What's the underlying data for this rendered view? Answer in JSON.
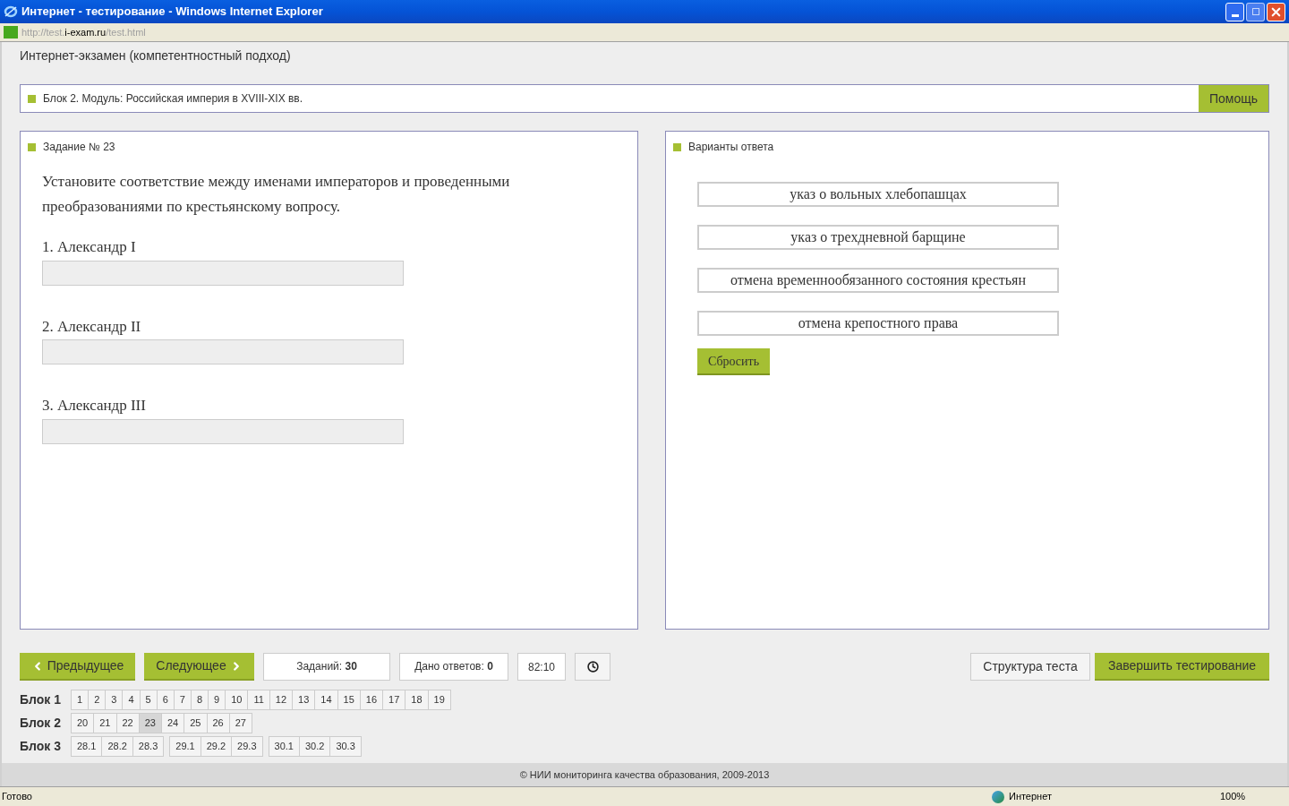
{
  "window": {
    "title": "Интернет - тестирование - Windows Internet Explorer"
  },
  "address": {
    "parts": [
      {
        "text": "http://test.",
        "highlighted": false
      },
      {
        "text": "i-exam.ru",
        "highlighted": true
      },
      {
        "text": "/test.html",
        "highlighted": false
      }
    ]
  },
  "page": {
    "title": "Интернет-экзамен (компетентностный подход)"
  },
  "module": {
    "label": "Блок 2. Модуль: Российская империя в XVIII-XIX вв.",
    "help_button": "Помощь"
  },
  "task": {
    "label": "Задание № 23",
    "question": "Установите соответствие между именами императоров и проведенными преобразованиями по крестьянскому вопросу.",
    "items": [
      {
        "label": "1. Александр I"
      },
      {
        "label": "2. Александр II"
      },
      {
        "label": "3. Александр III"
      }
    ]
  },
  "options": {
    "label": "Варианты ответа",
    "items": [
      "указ о вольных хлебопашцах",
      "указ о трехдневной барщине",
      "отмена временнообязанного состояния крестьян",
      "отмена крепостного права"
    ],
    "reset_button": "Сбросить"
  },
  "nav": {
    "previous": "Предыдущее",
    "next": "Следующее",
    "tasks_count": "Заданий: **30**",
    "answered": "Дано ответов: **0**",
    "timer": "82:10",
    "structure": "Структура теста",
    "finish": "Завершить тестирование"
  },
  "blocks": [
    {
      "label": "Блок 1",
      "groups": [
        [
          {
            "label": "1",
            "selected": false
          },
          {
            "label": "2",
            "selected": false
          },
          {
            "label": "3",
            "selected": false
          },
          {
            "label": "4",
            "selected": false
          },
          {
            "label": "5",
            "selected": false
          },
          {
            "label": "6",
            "selected": false
          },
          {
            "label": "7",
            "selected": false
          },
          {
            "label": "8",
            "selected": false
          },
          {
            "label": "9",
            "selected": false
          },
          {
            "label": "10",
            "selected": false
          },
          {
            "label": "11",
            "selected": false
          },
          {
            "label": "12",
            "selected": false
          },
          {
            "label": "13",
            "selected": false
          },
          {
            "label": "14",
            "selected": false
          },
          {
            "label": "15",
            "selected": false
          },
          {
            "label": "16",
            "selected": false
          },
          {
            "label": "17",
            "selected": false
          },
          {
            "label": "18",
            "selected": false
          },
          {
            "label": "19",
            "selected": false
          }
        ]
      ]
    },
    {
      "label": "Блок 2",
      "groups": [
        [
          {
            "label": "20",
            "selected": false
          },
          {
            "label": "21",
            "selected": false
          },
          {
            "label": "22",
            "selected": false
          },
          {
            "label": "23",
            "selected": true
          },
          {
            "label": "24",
            "selected": false
          },
          {
            "label": "25",
            "selected": false
          },
          {
            "label": "26",
            "selected": false
          },
          {
            "label": "27",
            "selected": false
          }
        ]
      ]
    },
    {
      "label": "Блок 3",
      "groups": [
        [
          {
            "label": "28.1",
            "selected": false
          },
          {
            "label": "28.2",
            "selected": false
          },
          {
            "label": "28.3",
            "selected": false
          }
        ],
        [
          {
            "label": "29.1",
            "selected": false
          },
          {
            "label": "29.2",
            "selected": false
          },
          {
            "label": "29.3",
            "selected": false
          }
        ],
        [
          {
            "label": "30.1",
            "selected": false
          },
          {
            "label": "30.2",
            "selected": false
          },
          {
            "label": "30.3",
            "selected": false
          }
        ]
      ]
    }
  ],
  "footer": {
    "text": "© НИИ мониторинга качества образования, 2009-2013"
  },
  "status_bar": {
    "text": "Готово",
    "zone": "Интернет",
    "zoom": "100%"
  }
}
